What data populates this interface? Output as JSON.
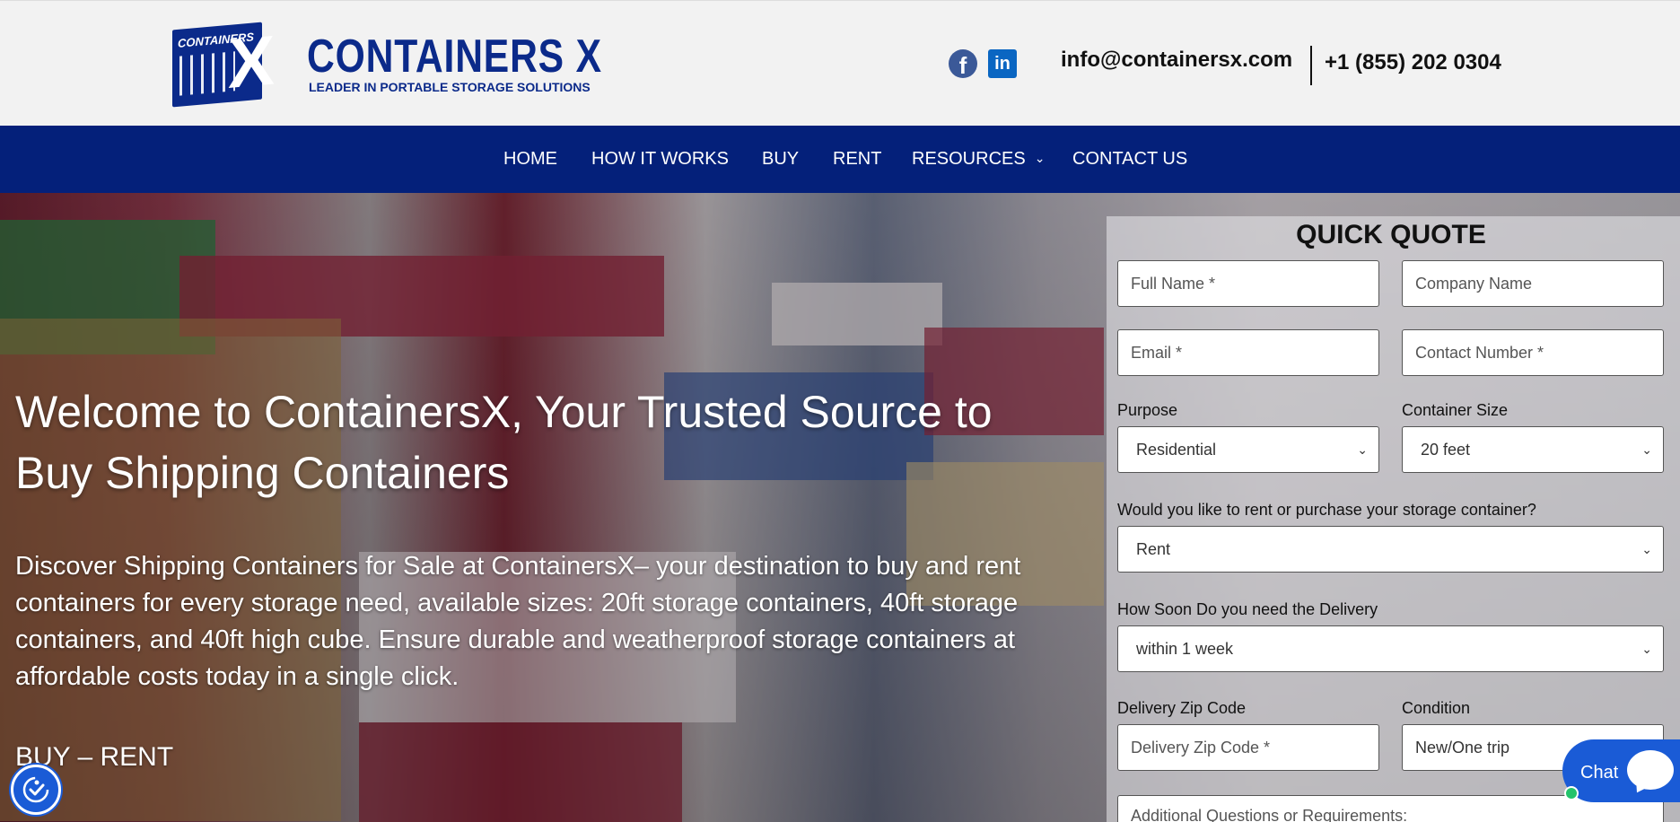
{
  "header": {
    "logo": {
      "mini_text": "CONTAINERS",
      "mark": "X",
      "name": "CONTAINERS X",
      "tagline": "LEADER IN PORTABLE STORAGE SOLUTIONS"
    },
    "social": [
      {
        "name": "facebook-icon",
        "glyph": "f"
      },
      {
        "name": "linkedin-icon",
        "glyph": "in"
      }
    ],
    "email": "info@containersx.com",
    "phone": "+1 (855) 202 0304"
  },
  "nav": {
    "items": [
      {
        "label": "HOME"
      },
      {
        "label": "HOW IT WORKS"
      },
      {
        "label": "BUY"
      },
      {
        "label": "RENT"
      },
      {
        "label": "RESOURCES",
        "has_dropdown": true
      },
      {
        "label": "CONTACT US"
      }
    ]
  },
  "hero": {
    "title": "Welcome to ContainersX, Your Trusted Source to Buy Shipping Containers",
    "description": "Discover Shipping Containers for Sale at ContainersX– your destination to buy and rent containers for every storage need, available sizes: 20ft storage containers, 40ft storage containers, and 40ft high cube. Ensure durable and weatherproof storage containers at affordable costs today in a single click.",
    "cta": "BUY – RENT"
  },
  "quote": {
    "title": "QUICK QUOTE",
    "full_name_placeholder": "Full Name *",
    "company_placeholder": "Company Name",
    "email_placeholder": "Email *",
    "contact_placeholder": "Contact Number *",
    "purpose_label": "Purpose",
    "purpose_value": "Residential",
    "size_label": "Container Size",
    "size_value": "20 feet",
    "rent_buy_label": "Would you like to rent or purchase your storage container?",
    "rent_buy_value": "Rent",
    "delivery_label": "How Soon Do you need the Delivery",
    "delivery_value": "within 1 week",
    "zip_label": "Delivery Zip Code",
    "zip_placeholder": "Delivery Zip Code *",
    "condition_label": "Condition",
    "condition_value": "New/One trip",
    "notes_placeholder": "Additional Questions or Requirements:"
  },
  "chat": {
    "label": "Chat"
  },
  "colors": {
    "brand_blue": "#0b2a8a",
    "nav_bg": "#04207a",
    "chat_blue": "#1a5bd6",
    "online_green": "#24c36b"
  }
}
